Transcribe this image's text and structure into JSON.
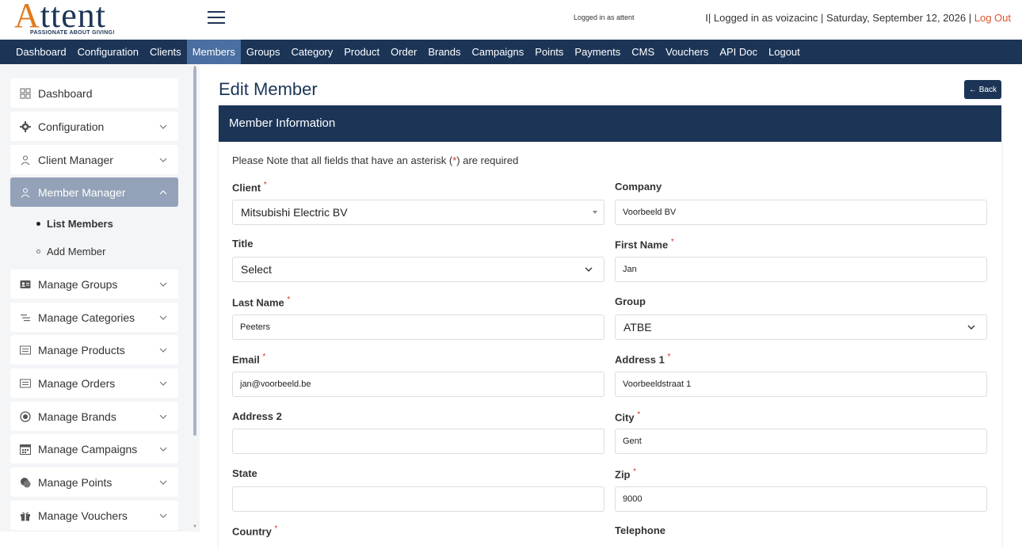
{
  "header": {
    "logo_text": "Attent",
    "logo_tagline": "PASSIONATE ABOUT GIVING!",
    "logged_in_small": "Logged in as attent",
    "logged_in_as": "I| Logged in as voizacinc | Saturday, September 12, 2026 |",
    "logout_link": "Log Out"
  },
  "topnav": [
    "Dashboard",
    "Configuration",
    "Clients",
    "Members",
    "Groups",
    "Category",
    "Product",
    "Order",
    "Brands",
    "Campaigns",
    "Points",
    "Payments",
    "CMS",
    "Vouchers",
    "API Doc",
    "Logout"
  ],
  "sidebar": {
    "items": [
      {
        "label": "Dashboard",
        "icon": "dashboard-icon"
      },
      {
        "label": "Configuration",
        "icon": "gear-icon"
      },
      {
        "label": "Client Manager",
        "icon": "user-icon"
      },
      {
        "label": "Member Manager",
        "icon": "user-icon"
      },
      {
        "label": "Manage Groups",
        "icon": "id-card-icon"
      },
      {
        "label": "Manage Categories",
        "icon": "list-icon"
      },
      {
        "label": "Manage Products",
        "icon": "list-box-icon"
      },
      {
        "label": "Manage Orders",
        "icon": "list-box-icon"
      },
      {
        "label": "Manage Brands",
        "icon": "target-icon"
      },
      {
        "label": "Manage Campaigns",
        "icon": "calendar-icon"
      },
      {
        "label": "Manage Points",
        "icon": "coins-icon"
      },
      {
        "label": "Manage Vouchers",
        "icon": "gift-icon"
      }
    ],
    "sub_items": [
      "List Members",
      "Add Member"
    ]
  },
  "main": {
    "title": "Edit Member",
    "back_label": "Back",
    "card_title": "Member Information",
    "note_prefix": "Please Note that all fields that have an asterisk (",
    "note_star": "*",
    "note_suffix": ") are required"
  },
  "form": {
    "client": {
      "label": "Client",
      "value": "Mitsubishi Electric BV"
    },
    "company": {
      "label": "Company",
      "value": "Voorbeeld BV"
    },
    "title": {
      "label": "Title",
      "value": "Select"
    },
    "first_name": {
      "label": "First Name",
      "value": "Jan"
    },
    "last_name": {
      "label": "Last Name",
      "value": "Peeters"
    },
    "group": {
      "label": "Group",
      "value": "ATBE"
    },
    "email": {
      "label": "Email",
      "value": "jan@voorbeeld.be"
    },
    "address1": {
      "label": "Address 1",
      "value": "Voorbeeldstraat 1"
    },
    "address2": {
      "label": "Address 2",
      "value": ""
    },
    "city": {
      "label": "City",
      "value": "Gent"
    },
    "state": {
      "label": "State",
      "value": ""
    },
    "zip": {
      "label": "Zip",
      "value": "9000"
    },
    "country": {
      "label": "Country"
    },
    "telephone": {
      "label": "Telephone"
    }
  },
  "colors": {
    "nav_bg": "#1c3557",
    "nav_active": "#4a6fa0",
    "accent_orange": "#e07a1f",
    "required_red": "#d9332b"
  }
}
